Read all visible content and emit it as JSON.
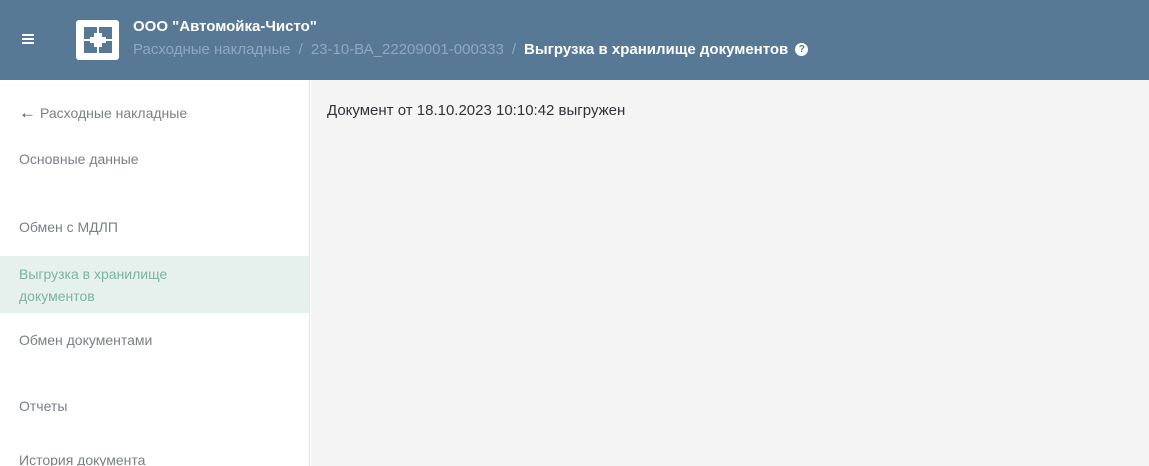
{
  "header": {
    "org_name": "ООО \"Автомойка-Чисто\"",
    "breadcrumb": {
      "section": "Расходные накладные",
      "separator": "/",
      "document": "23-10-ВА_22209001-000333",
      "current": "Выгрузка в хранилище документов"
    },
    "help_icon": "question-circle-icon",
    "menu_icon": "hamburger-icon",
    "logo_icon": "company-logo"
  },
  "sidebar": {
    "back_label": "Расходные накладные",
    "items": [
      {
        "label": "Основные данные"
      },
      {
        "label": "Обмен с МДЛП"
      },
      {
        "label": "Выгрузка в хранилище документов",
        "active": true
      },
      {
        "label": "Обмен документами"
      },
      {
        "label": "Отчеты"
      },
      {
        "label": "История документа"
      }
    ]
  },
  "main": {
    "status": "Документ от 18.10.2023 10:10:42 выгружен"
  },
  "colors": {
    "header_bg": "#587995",
    "active_item_bg": "#e6f1ee",
    "active_item_text": "#7bb3a0",
    "main_bg": "#f4f4f4"
  }
}
